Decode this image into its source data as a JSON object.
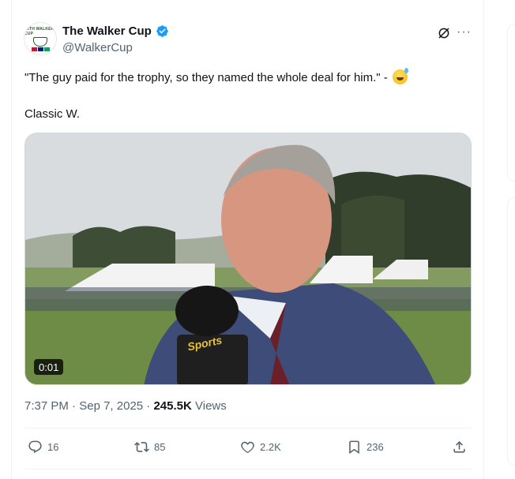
{
  "author": {
    "display_name": "The Walker Cup",
    "handle": "@WalkerCup",
    "avatar_text": "50TH WALKER CUP",
    "avatar_subtext": "Cypress Point"
  },
  "post": {
    "text_line1": "\"The guy paid for the trophy, so they named the whole deal for him.\" -",
    "text_line2": "Classic W.",
    "emoji": "grinning-face-with-sweat-emoji"
  },
  "media": {
    "duration": "0:01",
    "watermark": "Sports"
  },
  "meta": {
    "time": "7:37 PM",
    "date": "Sep 7, 2025",
    "views_count": "245.5K",
    "views_label": "Views"
  },
  "actions": {
    "replies": "16",
    "reposts": "85",
    "likes": "2.2K",
    "bookmarks": "236"
  },
  "colors": {
    "verified": "#1d9bf0",
    "text_secondary": "#536471",
    "text_primary": "#0f1419"
  }
}
